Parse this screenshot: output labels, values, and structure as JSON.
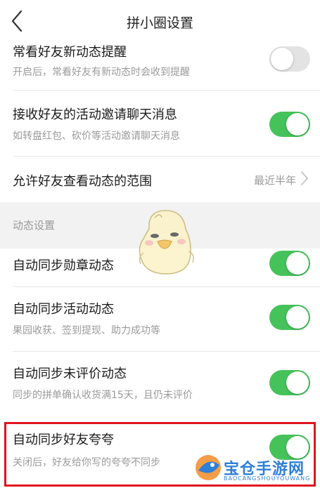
{
  "header": {
    "title": "拼小圈设置",
    "back_icon": "chevron-left-icon"
  },
  "settings_top": [
    {
      "label": "常看好友新动态提醒",
      "sub": "开启后，常看好友有新动态时会收到提醒",
      "enabled": false
    },
    {
      "label": "接收好友的活动邀请聊天消息",
      "sub": "如转盘红包、砍价等活动邀请聊天消息",
      "enabled": true
    }
  ],
  "visibility_range": {
    "label": "允许好友查看动态的范围",
    "value": "最近半年"
  },
  "section": {
    "title": "动态设置"
  },
  "settings_dynamic": [
    {
      "label": "自动同步勋章动态",
      "sub": "",
      "enabled": true
    },
    {
      "label": "自动同步活动动态",
      "sub": "果园收获、签到提现、助力成功等",
      "enabled": true
    },
    {
      "label": "自动同步未评价动态",
      "sub": "同步的拼单确认收货满15天，且仍未评价",
      "enabled": true
    },
    {
      "label": "自动同步好友夸夸",
      "sub": "关闭后，好友给你写的夸夸不同步",
      "enabled": true
    }
  ],
  "watermark": {
    "text": "宝仓手游网",
    "sub": "BAOCANGSHOUYOUWANG"
  },
  "colors": {
    "toggle_on": "#45c35a",
    "toggle_off": "#e3e3e3",
    "highlight_border": "#e0141e",
    "watermark": "#2e7fd8"
  }
}
